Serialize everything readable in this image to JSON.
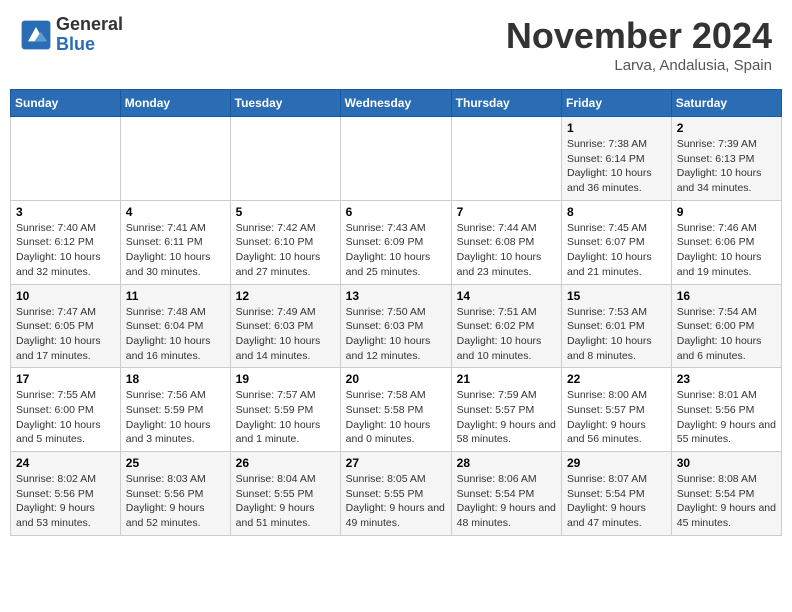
{
  "header": {
    "logo_line1": "General",
    "logo_line2": "Blue",
    "month": "November 2024",
    "location": "Larva, Andalusia, Spain"
  },
  "weekdays": [
    "Sunday",
    "Monday",
    "Tuesday",
    "Wednesday",
    "Thursday",
    "Friday",
    "Saturday"
  ],
  "weeks": [
    [
      {
        "day": "",
        "info": ""
      },
      {
        "day": "",
        "info": ""
      },
      {
        "day": "",
        "info": ""
      },
      {
        "day": "",
        "info": ""
      },
      {
        "day": "",
        "info": ""
      },
      {
        "day": "1",
        "info": "Sunrise: 7:38 AM\nSunset: 6:14 PM\nDaylight: 10 hours and 36 minutes."
      },
      {
        "day": "2",
        "info": "Sunrise: 7:39 AM\nSunset: 6:13 PM\nDaylight: 10 hours and 34 minutes."
      }
    ],
    [
      {
        "day": "3",
        "info": "Sunrise: 7:40 AM\nSunset: 6:12 PM\nDaylight: 10 hours and 32 minutes."
      },
      {
        "day": "4",
        "info": "Sunrise: 7:41 AM\nSunset: 6:11 PM\nDaylight: 10 hours and 30 minutes."
      },
      {
        "day": "5",
        "info": "Sunrise: 7:42 AM\nSunset: 6:10 PM\nDaylight: 10 hours and 27 minutes."
      },
      {
        "day": "6",
        "info": "Sunrise: 7:43 AM\nSunset: 6:09 PM\nDaylight: 10 hours and 25 minutes."
      },
      {
        "day": "7",
        "info": "Sunrise: 7:44 AM\nSunset: 6:08 PM\nDaylight: 10 hours and 23 minutes."
      },
      {
        "day": "8",
        "info": "Sunrise: 7:45 AM\nSunset: 6:07 PM\nDaylight: 10 hours and 21 minutes."
      },
      {
        "day": "9",
        "info": "Sunrise: 7:46 AM\nSunset: 6:06 PM\nDaylight: 10 hours and 19 minutes."
      }
    ],
    [
      {
        "day": "10",
        "info": "Sunrise: 7:47 AM\nSunset: 6:05 PM\nDaylight: 10 hours and 17 minutes."
      },
      {
        "day": "11",
        "info": "Sunrise: 7:48 AM\nSunset: 6:04 PM\nDaylight: 10 hours and 16 minutes."
      },
      {
        "day": "12",
        "info": "Sunrise: 7:49 AM\nSunset: 6:03 PM\nDaylight: 10 hours and 14 minutes."
      },
      {
        "day": "13",
        "info": "Sunrise: 7:50 AM\nSunset: 6:03 PM\nDaylight: 10 hours and 12 minutes."
      },
      {
        "day": "14",
        "info": "Sunrise: 7:51 AM\nSunset: 6:02 PM\nDaylight: 10 hours and 10 minutes."
      },
      {
        "day": "15",
        "info": "Sunrise: 7:53 AM\nSunset: 6:01 PM\nDaylight: 10 hours and 8 minutes."
      },
      {
        "day": "16",
        "info": "Sunrise: 7:54 AM\nSunset: 6:00 PM\nDaylight: 10 hours and 6 minutes."
      }
    ],
    [
      {
        "day": "17",
        "info": "Sunrise: 7:55 AM\nSunset: 6:00 PM\nDaylight: 10 hours and 5 minutes."
      },
      {
        "day": "18",
        "info": "Sunrise: 7:56 AM\nSunset: 5:59 PM\nDaylight: 10 hours and 3 minutes."
      },
      {
        "day": "19",
        "info": "Sunrise: 7:57 AM\nSunset: 5:59 PM\nDaylight: 10 hours and 1 minute."
      },
      {
        "day": "20",
        "info": "Sunrise: 7:58 AM\nSunset: 5:58 PM\nDaylight: 10 hours and 0 minutes."
      },
      {
        "day": "21",
        "info": "Sunrise: 7:59 AM\nSunset: 5:57 PM\nDaylight: 9 hours and 58 minutes."
      },
      {
        "day": "22",
        "info": "Sunrise: 8:00 AM\nSunset: 5:57 PM\nDaylight: 9 hours and 56 minutes."
      },
      {
        "day": "23",
        "info": "Sunrise: 8:01 AM\nSunset: 5:56 PM\nDaylight: 9 hours and 55 minutes."
      }
    ],
    [
      {
        "day": "24",
        "info": "Sunrise: 8:02 AM\nSunset: 5:56 PM\nDaylight: 9 hours and 53 minutes."
      },
      {
        "day": "25",
        "info": "Sunrise: 8:03 AM\nSunset: 5:56 PM\nDaylight: 9 hours and 52 minutes."
      },
      {
        "day": "26",
        "info": "Sunrise: 8:04 AM\nSunset: 5:55 PM\nDaylight: 9 hours and 51 minutes."
      },
      {
        "day": "27",
        "info": "Sunrise: 8:05 AM\nSunset: 5:55 PM\nDaylight: 9 hours and 49 minutes."
      },
      {
        "day": "28",
        "info": "Sunrise: 8:06 AM\nSunset: 5:54 PM\nDaylight: 9 hours and 48 minutes."
      },
      {
        "day": "29",
        "info": "Sunrise: 8:07 AM\nSunset: 5:54 PM\nDaylight: 9 hours and 47 minutes."
      },
      {
        "day": "30",
        "info": "Sunrise: 8:08 AM\nSunset: 5:54 PM\nDaylight: 9 hours and 45 minutes."
      }
    ]
  ]
}
